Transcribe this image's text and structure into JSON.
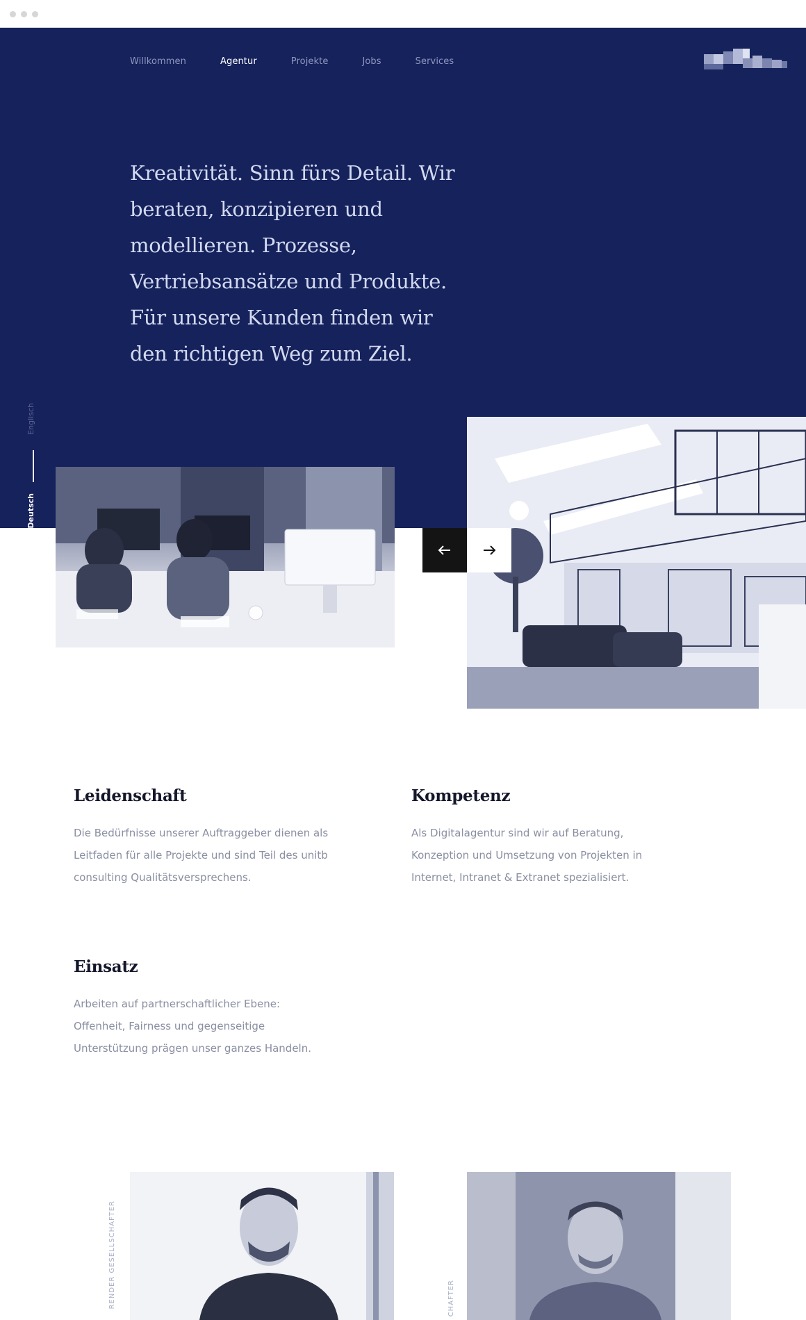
{
  "nav": {
    "items": [
      {
        "label": "Willkommen",
        "active": false
      },
      {
        "label": "Agentur",
        "active": true
      },
      {
        "label": "Projekte",
        "active": false
      },
      {
        "label": "Jobs",
        "active": false
      },
      {
        "label": "Services",
        "active": false
      }
    ]
  },
  "hero": {
    "headline": "Kreativität. Sinn fürs Detail. Wir beraten, konzipieren und modellieren. Prozesse, Vertriebsansätze und Produkte. Für unsere Kunden finden wir den richtigen Weg zum Ziel."
  },
  "language": {
    "options": [
      "Englisch",
      "Deutsch"
    ],
    "active": "Deutsch"
  },
  "slider": {
    "prev_icon": "arrow-left-icon",
    "next_icon": "arrow-right-icon"
  },
  "features": [
    {
      "title": "Leidenschaft",
      "text": "Die Bedürfnisse unserer Auftraggeber dienen als Leitfaden für alle Projekte und sind Teil des unitb consulting Qualitätsversprechens."
    },
    {
      "title": "Kompetenz",
      "text": "Als Digitalagentur sind wir auf Beratung, Konzeption und Umsetzung von Projekten in Internet, Intranet & Extranet spezialisiert."
    },
    {
      "title": "Einsatz",
      "text": "Arbeiten auf partnerschaftlicher Ebene: Offenheit, Fairness und gegenseitige Unterstützung prägen unser ganzes Handeln."
    }
  ],
  "team": [
    {
      "role": "RENDER GESELLSCHAFTER"
    },
    {
      "role": "CHAFTER"
    }
  ],
  "colors": {
    "hero_bg": "#16225c",
    "nav_inactive": "#8e97bf",
    "headline": "#d3d9ef",
    "body_text": "#8a8fa2"
  }
}
